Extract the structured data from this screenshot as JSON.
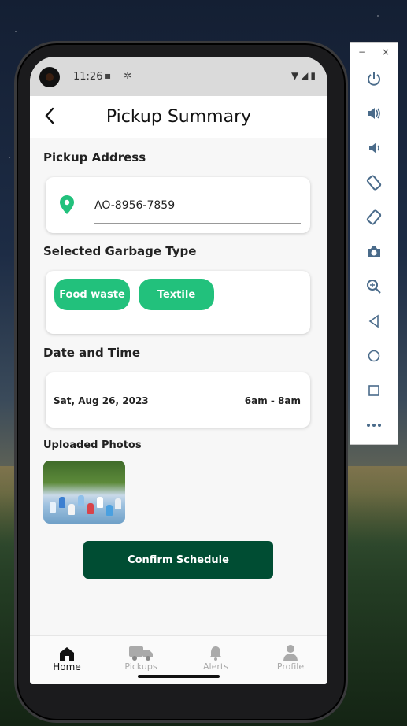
{
  "status_bar": {
    "time": "11:26"
  },
  "app_bar": {
    "title": "Pickup Summary",
    "back_glyph": "‹"
  },
  "pickup_address": {
    "label": "Pickup Address",
    "value": "AO-8956-7859"
  },
  "garbage": {
    "label": "Selected Garbage Type",
    "chips": [
      "Food waste",
      "Textile"
    ]
  },
  "date_time": {
    "label": "Date and Time",
    "date": "Sat, Aug 26, 2023",
    "time": "6am - 8am"
  },
  "photos": {
    "label": "Uploaded Photos"
  },
  "confirm_button": "Confirm Schedule",
  "bottom_nav": [
    {
      "label": "Home",
      "icon": "home-icon",
      "active": true
    },
    {
      "label": "Pickups",
      "icon": "truck-icon",
      "active": false
    },
    {
      "label": "Alerts",
      "icon": "bell-icon",
      "active": false
    },
    {
      "label": "Profile",
      "icon": "person-icon",
      "active": false
    }
  ],
  "emulator_panel": {
    "window_controls": [
      "−",
      "×"
    ],
    "buttons": [
      "power-icon",
      "volume-up-icon",
      "volume-down-icon",
      "rotate-left-icon",
      "rotate-right-icon",
      "camera-icon",
      "zoom-icon",
      "back-icon",
      "home-circle-icon",
      "overview-icon",
      "more-icon"
    ]
  },
  "colors": {
    "accent": "#22c17c",
    "primary_dark": "#004d33",
    "pin": "#22c17c"
  }
}
